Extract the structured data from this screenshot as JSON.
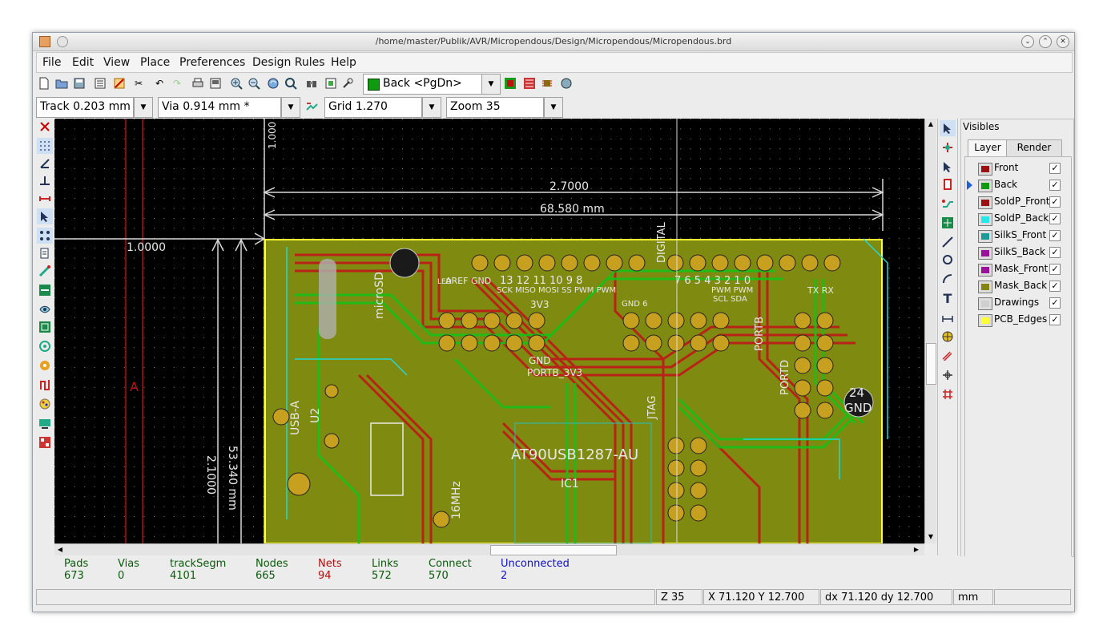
{
  "window": {
    "title": "/home/master/Publik/AVR/Micropendous/Design/Micropendous/Micropendous.brd",
    "controls": [
      "minimize",
      "maximize",
      "close"
    ]
  },
  "menu": {
    "items": [
      "File",
      "Edit",
      "View",
      "Place",
      "Preferences",
      "Design Rules",
      "Help"
    ]
  },
  "toolbar": {
    "icons": [
      "new-board-icon",
      "open-icon",
      "save-icon",
      "page-settings-icon",
      "board-setup-icon",
      "cut-icon",
      "undo-icon",
      "redo-icon",
      "print-icon",
      "plot-icon",
      "zoom-in-icon",
      "zoom-out-icon",
      "zoom-redraw-icon",
      "zoom-fit-icon",
      "find-icon",
      "netlist-icon",
      "drc-icon"
    ],
    "layer_select": "Back <PgDn>",
    "layer_color": "#0f9a0f",
    "after_icons": [
      "layer-pair-icon",
      "autoroute-icon",
      "autoplace-icon",
      "web-icon"
    ]
  },
  "aux_toolbar": {
    "track": "Track 0.203 mm *",
    "via": "Via 0.914 mm *",
    "grid": "Grid 1.270",
    "zoom": "Zoom 35"
  },
  "canvas": {
    "dim_top_text": "2.7000",
    "dim_top_mm": "68.580 mm",
    "dim_left_text": "1.0000",
    "dim_side_top": "1.000",
    "dim_vert_text": "2.1000",
    "dim_vert_mm": "53.340 mm",
    "ref_letter": "A",
    "chip_label": "AT90USB1287-AU",
    "ic_label": "IC1",
    "board_labels": {
      "microsd": "microSD",
      "usb": "USB-A",
      "u2": "U2",
      "clk": "16MHz",
      "portb": "PORTB",
      "portb_3v3": "PORTB_3V3",
      "gnd_right": "GND",
      "pin24": "24",
      "digital": "DIGITAL",
      "led": "LED",
      "aref": "AREF GND",
      "pin_nums": "13 12 11 10 9 8",
      "pin_nums2": "7 6 5 4 3 2 1 0",
      "spi": "SCK MISO MOSI SS PWM PWM",
      "pwm2": "PWM PWM",
      "i2c": "SCL SDA",
      "txrx": "TX  RX",
      "gnd6": "GND  6",
      "v3v3": "3V3",
      "gnd2": "GND",
      "jtag": "JTAG",
      "portd": "PORTD"
    }
  },
  "right_toolbar": {
    "icons": [
      "select-icon",
      "highlight-net-icon",
      "local-ratsnest-icon",
      "add-module-icon",
      "add-track-icon",
      "add-zone-icon",
      "add-line-icon",
      "add-circle-icon",
      "add-arc-icon",
      "add-text-icon",
      "add-dimension-icon",
      "add-target-icon",
      "delete-icon",
      "offset-origin-icon",
      "grid-origin-icon"
    ]
  },
  "left_toolbar": {
    "icons": [
      "drc-off-icon",
      "grid-icon",
      "polar-coords-icon",
      "units-inch-icon",
      "units-mm-icon",
      "cursor-shape-icon",
      "ratsnest-icon",
      "module-ratsnest-icon",
      "auto-delete-track-icon",
      "zones-show-icon",
      "zones-hide-icon",
      "zones-outline-icon",
      "pads-sketch-icon",
      "vias-sketch-icon",
      "tracks-sketch-icon",
      "high-contrast-icon",
      "microwave-toolbar-icon",
      "layers-manager-icon"
    ]
  },
  "visibles": {
    "title": "Visibles",
    "tabs": [
      "Layer",
      "Render"
    ],
    "layers": [
      {
        "name": "Front",
        "color": "#9b1111",
        "checked": "✓",
        "active": false
      },
      {
        "name": "Back",
        "color": "#0f9a0f",
        "checked": "✓",
        "active": true
      },
      {
        "name": "SoldP_Front",
        "color": "#9b1111",
        "checked": "✓",
        "active": false
      },
      {
        "name": "SoldP_Back",
        "color": "#25e8e8",
        "checked": "✓",
        "active": false
      },
      {
        "name": "SilkS_Front",
        "color": "#1c9a9a",
        "checked": "✓",
        "active": false
      },
      {
        "name": "SilkS_Back",
        "color": "#9b119b",
        "checked": "✓",
        "active": false
      },
      {
        "name": "Mask_Front",
        "color": "#9b119b",
        "checked": "✓",
        "active": false
      },
      {
        "name": "Mask_Back",
        "color": "#848411",
        "checked": "✓",
        "active": false
      },
      {
        "name": "Drawings",
        "color": "#cfcfcf",
        "checked": "✓",
        "active": false
      },
      {
        "name": "PCB_Edges",
        "color": "#ffff33",
        "checked": "✓",
        "active": false
      }
    ]
  },
  "messages": [
    {
      "label": "Pads",
      "value": "673",
      "color": "#0a5a0a"
    },
    {
      "label": "Vias",
      "value": "0",
      "color": "#0a5a0a"
    },
    {
      "label": "trackSegm",
      "value": "4101",
      "color": "#0a5a0a"
    },
    {
      "label": "Nodes",
      "value": "665",
      "color": "#0a5a0a"
    },
    {
      "label": "Nets",
      "value": "94",
      "color": "#b01010"
    },
    {
      "label": "Links",
      "value": "572",
      "color": "#0a5a0a"
    },
    {
      "label": "Connect",
      "value": "570",
      "color": "#0a5a0a"
    },
    {
      "label": "Unconnected",
      "value": "2",
      "color": "#1010c0"
    }
  ],
  "status": {
    "zoom": "Z 35",
    "abs": "X 71.120  Y 12.700",
    "rel": "dx 71.120  dy 12.700",
    "units": "mm"
  }
}
